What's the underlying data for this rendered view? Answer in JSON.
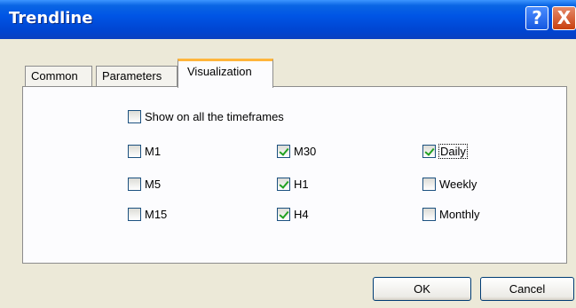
{
  "window": {
    "title": "Trendline",
    "help_symbol": "?",
    "close_symbol": "X"
  },
  "tabs": [
    {
      "label": "Common",
      "active": false
    },
    {
      "label": "Parameters",
      "active": false
    },
    {
      "label": "Visualization",
      "active": true
    }
  ],
  "visualization": {
    "all_timeframes": {
      "label": "Show on all the timeframes",
      "checked": false
    },
    "timeframes": [
      {
        "label": "M1",
        "checked": false
      },
      {
        "label": "M5",
        "checked": false
      },
      {
        "label": "M15",
        "checked": false
      },
      {
        "label": "M30",
        "checked": true
      },
      {
        "label": "H1",
        "checked": true
      },
      {
        "label": "H4",
        "checked": true
      },
      {
        "label": "Daily",
        "checked": true
      },
      {
        "label": "Weekly",
        "checked": false
      },
      {
        "label": "Monthly",
        "checked": false
      }
    ]
  },
  "buttons": {
    "ok": "OK",
    "cancel": "Cancel"
  },
  "icons": {
    "help": "help-icon",
    "close": "close-icon",
    "checkmark": "checkmark-icon"
  },
  "colors": {
    "titlebar": "#0055e5",
    "active_tab_accent": "#ffb53c",
    "checkmark": "#21a121",
    "close_button": "#c8400f"
  }
}
